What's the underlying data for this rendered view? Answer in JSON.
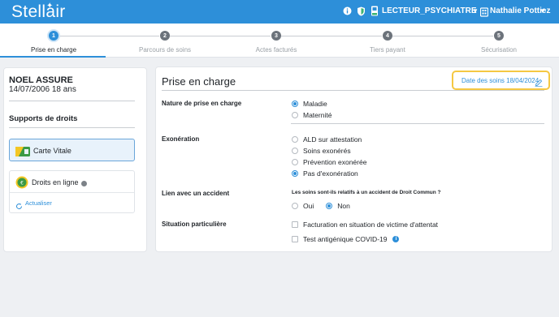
{
  "header": {
    "logo": "Stellair",
    "role": "LECTEUR_PSYCHIATRE",
    "user_name": "Nathalie Pottiez",
    "icons": [
      "info-icon",
      "shield-icon",
      "card-reader-icon"
    ],
    "brand_color": "#2d8fd9"
  },
  "stepper": {
    "steps": [
      {
        "number": "1",
        "label": "Prise en charge",
        "active": true
      },
      {
        "number": "2",
        "label": "Parcours de soins",
        "active": false
      },
      {
        "number": "3",
        "label": "Actes facturés",
        "active": false
      },
      {
        "number": "4",
        "label": "Tiers payant",
        "active": false
      },
      {
        "number": "5",
        "label": "Sécurisation",
        "active": false
      }
    ]
  },
  "patient": {
    "name": "NOEL ASSURE",
    "dob_age": "14/07/2006 18 ans"
  },
  "rights": {
    "title": "Supports de droits",
    "carte_vitale": "Carte Vitale",
    "droits_en_ligne": "Droits en ligne",
    "actualiser": "Actualiser"
  },
  "main": {
    "title": "Prise en charge",
    "date_label": "Date des soins 18/04/2024",
    "nature": {
      "label": "Nature de prise en charge",
      "options": [
        {
          "label": "Maladie",
          "selected": true
        },
        {
          "label": "Maternité",
          "selected": false
        }
      ]
    },
    "exoneration": {
      "label": "Exonération",
      "options": [
        {
          "label": "ALD sur attestation",
          "selected": false
        },
        {
          "label": "Soins exonérés",
          "selected": false
        },
        {
          "label": "Prévention exonérée",
          "selected": false
        },
        {
          "label": "Pas d'exonération",
          "selected": true
        }
      ]
    },
    "accident": {
      "label": "Lien avec un accident",
      "question": "Les soins sont-ils relatifs à un accident de Droit Commun ?",
      "options": [
        {
          "label": "Oui",
          "selected": false
        },
        {
          "label": "Non",
          "selected": true
        }
      ]
    },
    "situation": {
      "label": "Situation particulière",
      "options": [
        {
          "label": "Facturation en situation de victime d'attentat",
          "checked": false
        },
        {
          "label": "Test antigénique COVID-19",
          "checked": false
        }
      ]
    }
  }
}
